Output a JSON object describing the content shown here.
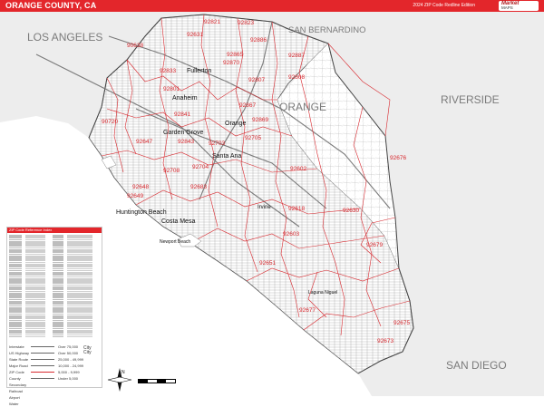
{
  "header": {
    "title": "ORANGE COUNTY, CA",
    "edition": "2024 ZIP Code Redline Edition",
    "logo_line1": "Market",
    "logo_line2": "MAPS"
  },
  "colors": {
    "accent": "#e3262b",
    "zip_line": "#d8282e",
    "land": "#ffffff",
    "outside": "#ececec",
    "water": "#ffffff"
  },
  "regions": {
    "los_angeles": "LOS ANGELES",
    "san_bernardino": "SAN BERNARDINO",
    "riverside": "RIVERSIDE",
    "san_diego": "SAN DIEGO",
    "orange": "ORANGE"
  },
  "cities": {
    "fullerton": "Fullerton",
    "anaheim": "Anaheim",
    "orange": "Orange",
    "garden_grove": "Garden Grove",
    "santa_ana": "Santa Ana",
    "huntington_beach": "Huntington Beach",
    "costa_mesa": "Costa Mesa",
    "newport_beach": "Newport Beach",
    "irvine": "Irvine",
    "laguna_niguel": "Laguna Niguel"
  },
  "zips": {
    "z92821": "92821",
    "z92823": "92823",
    "z90638": "90638",
    "z92651a": "92631",
    "z92886": "92886",
    "z92887": "92887",
    "z92808": "92808",
    "z92833": "92833",
    "z92807": "92807",
    "z92870": "92870",
    "z92801": "92801",
    "z92869": "92869",
    "z90720": "90720",
    "z92841": "92841",
    "z92843": "92843",
    "z92705": "92705",
    "z92647": "92647",
    "z92703": "92703",
    "z92708": "92708",
    "z92704": "92704",
    "z92602": "92602",
    "z92676": "92676",
    "z92648": "92648",
    "z92649": "92649",
    "z92618": "92618",
    "z92603": "92603",
    "z92630": "92630",
    "z92679": "92679",
    "z92651": "92651",
    "z92677": "92677",
    "z92675": "92675",
    "z92673": "92673",
    "z92867": "92867",
    "z92865": "92865",
    "z92704b": "92683"
  },
  "legend": {
    "header": "ZIP Code Reference Index"
  },
  "legend_keys": [
    {
      "label": "Interstate",
      "text": "Over 75,000"
    },
    {
      "label": "US Highway",
      "text": "Over 50,000"
    },
    {
      "label": "State Route",
      "text": "25,000 - 49,999"
    },
    {
      "label": "Major Road",
      "text": "10,000 - 24,999"
    },
    {
      "label": "ZIP Code",
      "text": "5,000 - 9,999"
    },
    {
      "label": "County",
      "text": "Under 5,000"
    },
    {
      "label": "Secondary",
      "text": ""
    },
    {
      "label": "Railroad",
      "text": ""
    },
    {
      "label": "Airport",
      "text": ""
    },
    {
      "label": "Water",
      "text": ""
    }
  ],
  "legend_city": {
    "line1": "City",
    "line2": "City"
  },
  "compass": "N"
}
